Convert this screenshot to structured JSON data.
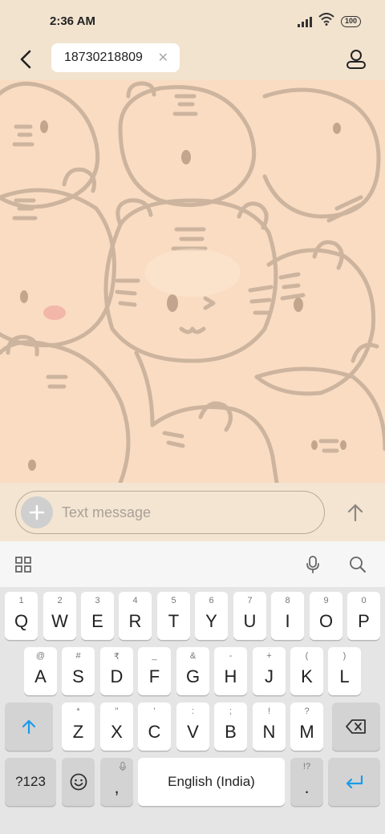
{
  "status_bar": {
    "time": "2:36 AM",
    "battery": "100",
    "icons": [
      "signal-icon",
      "wifi-icon",
      "battery-icon"
    ]
  },
  "header": {
    "back_icon": "back-arrow-icon",
    "recipient": "18730218809",
    "remove_icon": "close-icon",
    "contact_icon": "person-icon"
  },
  "composer": {
    "placeholder": "Text message",
    "add_icon": "plus-icon",
    "send_icon": "send-arrow-icon"
  },
  "keyboard_toolbar": {
    "icons": [
      "apps-grid-icon",
      "microphone-icon",
      "search-icon"
    ]
  },
  "keyboard": {
    "row1": [
      {
        "key": "Q",
        "hint": "1"
      },
      {
        "key": "W",
        "hint": "2"
      },
      {
        "key": "E",
        "hint": "3"
      },
      {
        "key": "R",
        "hint": "4"
      },
      {
        "key": "T",
        "hint": "5"
      },
      {
        "key": "Y",
        "hint": "6"
      },
      {
        "key": "U",
        "hint": "7"
      },
      {
        "key": "I",
        "hint": "8"
      },
      {
        "key": "O",
        "hint": "9"
      },
      {
        "key": "P",
        "hint": "0"
      }
    ],
    "row2": [
      {
        "key": "A",
        "hint": "@"
      },
      {
        "key": "S",
        "hint": "#"
      },
      {
        "key": "D",
        "hint": "₹"
      },
      {
        "key": "F",
        "hint": "_"
      },
      {
        "key": "G",
        "hint": "&"
      },
      {
        "key": "H",
        "hint": "-"
      },
      {
        "key": "J",
        "hint": "+"
      },
      {
        "key": "K",
        "hint": "("
      },
      {
        "key": "L",
        "hint": ")"
      }
    ],
    "row3": [
      {
        "key": "Z",
        "hint": "*"
      },
      {
        "key": "X",
        "hint": "\""
      },
      {
        "key": "C",
        "hint": "'"
      },
      {
        "key": "V",
        "hint": ":"
      },
      {
        "key": "B",
        "hint": ";"
      },
      {
        "key": "N",
        "hint": "!"
      },
      {
        "key": "M",
        "hint": "?"
      }
    ],
    "shift_icon": "shift-arrow-icon",
    "backspace_icon": "backspace-icon",
    "symbols_label": "?123",
    "emoji_icon": "smiley-icon",
    "comma_label": ",",
    "space_label": "English (India)",
    "period_label": ".",
    "period_hint": "!?",
    "enter_icon": "enter-icon"
  },
  "colors": {
    "header_bg": "#f2e3cf",
    "wallpaper_bg": "#f9dcc2",
    "accent_blue": "#1a9be8",
    "keyboard_bg": "#e5e5e5"
  }
}
